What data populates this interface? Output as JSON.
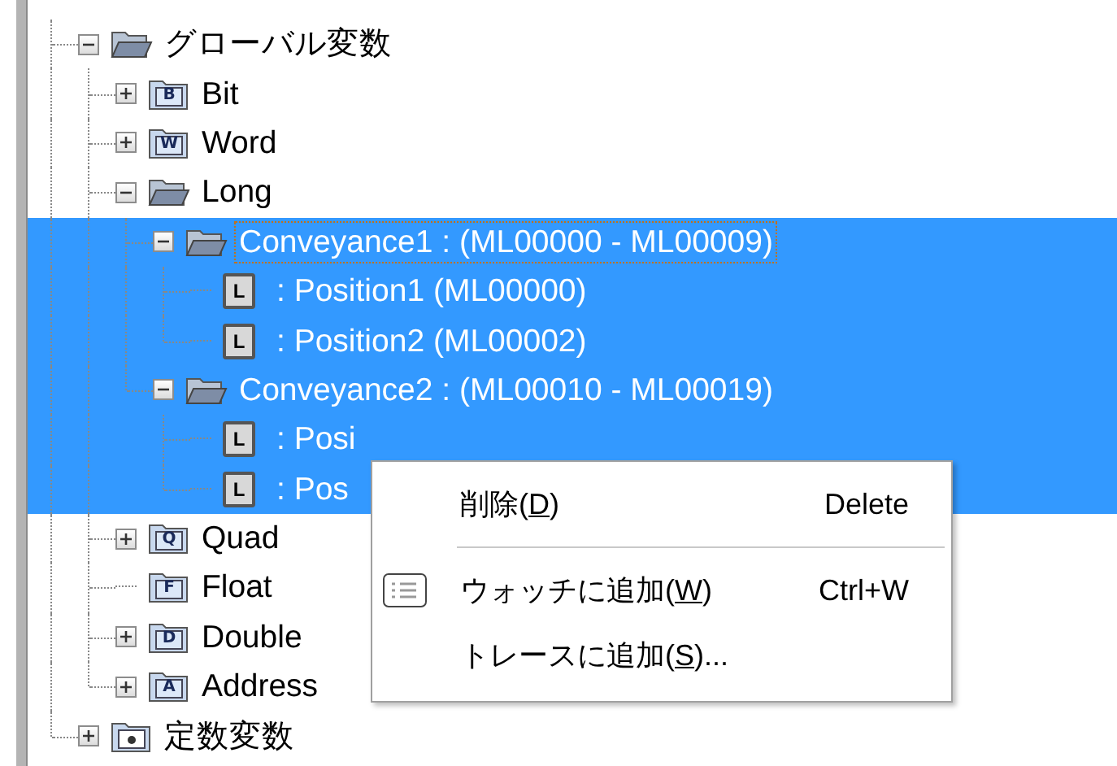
{
  "tree": [
    {
      "label": "グローバル変数",
      "kind": "open-folder",
      "expanded": true,
      "selected": false,
      "focused": false,
      "children": [
        {
          "label": "Bit",
          "kind": "folder",
          "letter": "B",
          "expanded": false,
          "selected": false,
          "focused": false
        },
        {
          "label": "Word",
          "kind": "folder",
          "letter": "W",
          "expanded": false,
          "selected": false,
          "focused": false
        },
        {
          "label": "Long",
          "kind": "open-folder",
          "expanded": true,
          "selected": false,
          "focused": false,
          "children": [
            {
              "label": "Conveyance1 : (ML00000 - ML00009)",
              "kind": "open-folder",
              "expanded": true,
              "selected": true,
              "focused": true,
              "children": [
                {
                  "label": ": Position1 (ML00000)",
                  "kind": "variable",
                  "letter": "L",
                  "selected": true,
                  "focused": false
                },
                {
                  "label": ": Position2 (ML00002)",
                  "kind": "variable",
                  "letter": "L",
                  "selected": true,
                  "focused": false
                }
              ]
            },
            {
              "label": "Conveyance2 : (ML00010 - ML00019)",
              "kind": "open-folder",
              "expanded": true,
              "selected": true,
              "focused": false,
              "children": [
                {
                  "label": ": Posi",
                  "kind": "variable",
                  "letter": "L",
                  "selected": true,
                  "focused": false
                },
                {
                  "label": ": Pos",
                  "kind": "variable",
                  "letter": "L",
                  "selected": true,
                  "focused": false
                }
              ]
            }
          ]
        },
        {
          "label": "Quad",
          "kind": "folder",
          "letter": "Q",
          "expanded": false,
          "selected": false,
          "focused": false
        },
        {
          "label": "Float",
          "kind": "folder",
          "letter": "F",
          "selected": false,
          "focused": false
        },
        {
          "label": "Double",
          "kind": "folder",
          "letter": "D",
          "expanded": false,
          "selected": false,
          "focused": false
        },
        {
          "label": "Address",
          "kind": "folder",
          "letter": "A",
          "expanded": false,
          "selected": false,
          "focused": false
        }
      ]
    },
    {
      "label": "定数変数",
      "kind": "const-folder",
      "expanded": false,
      "selected": false,
      "focused": false
    }
  ],
  "context_menu": [
    {
      "kind": "item",
      "before": "削除(",
      "mnemonic": "D",
      "after": ")",
      "shortcut": "Delete"
    },
    {
      "kind": "separator"
    },
    {
      "kind": "icon-item",
      "before": "ウォッチに追加(",
      "mnemonic": "W",
      "after": ")",
      "shortcut": "Ctrl+W"
    },
    {
      "kind": "item",
      "before": "トレースに追加(",
      "mnemonic": "S",
      "after": ")..."
    }
  ]
}
